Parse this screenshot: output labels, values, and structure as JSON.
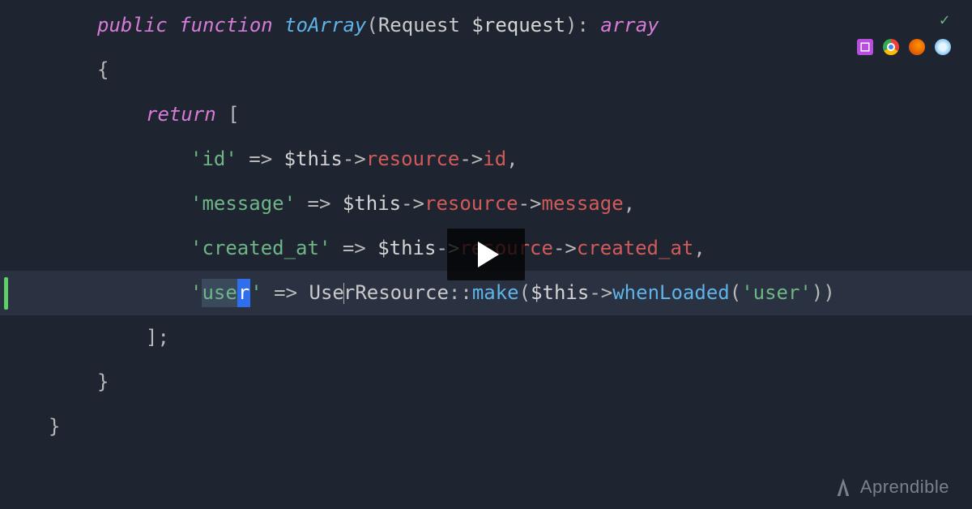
{
  "toolbar": {
    "check_icon": "check-icon",
    "icons": [
      "ide-icon",
      "chrome-icon",
      "firefox-icon",
      "safari-icon"
    ]
  },
  "code": {
    "l1": {
      "mod": "public",
      "kw": "function",
      "fn": "toArray",
      "paren_open": "(",
      "arg_type": "Request",
      "arg_var": "$request",
      "paren_close": ")",
      "colon": ":",
      "ret": "array"
    },
    "l2": {
      "brace": "{"
    },
    "l3": {
      "kw": "return",
      "bracket": " ["
    },
    "l4": {
      "key": "'id'",
      "arrow": " => ",
      "this": "$this",
      "arr1": "->",
      "p1": "resource",
      "arr2": "->",
      "p2": "id",
      "end": ","
    },
    "l5": {
      "key": "'message'",
      "arrow": " => ",
      "this": "$this",
      "arr1": "->",
      "p1": "resource",
      "arr2": "->",
      "p2": "message",
      "end": ","
    },
    "l6": {
      "key": "'created_at'",
      "arrow": " => ",
      "this": "$this",
      "arr1": "->",
      "p1": "resource",
      "arr2": "->",
      "p2": "created_at",
      "end": ","
    },
    "l7": {
      "q1": "'",
      "key_a": "use",
      "key_sel": "r",
      "q2": "'",
      "arrow": " => ",
      "class_a": "Use",
      "class_b": "rResource",
      "scope": "::",
      "method": "make",
      "open": "(",
      "this": "$this",
      "arr1": "->",
      "when": "whenLoaded",
      "open2": "(",
      "arg": "'user'",
      "close": "))"
    },
    "l8": {
      "close": "];"
    },
    "l9": {
      "brace": "}"
    },
    "l10": {
      "brace": "}"
    }
  },
  "overlay": {
    "play": "play-button"
  },
  "watermark": {
    "text": "Aprendible"
  }
}
